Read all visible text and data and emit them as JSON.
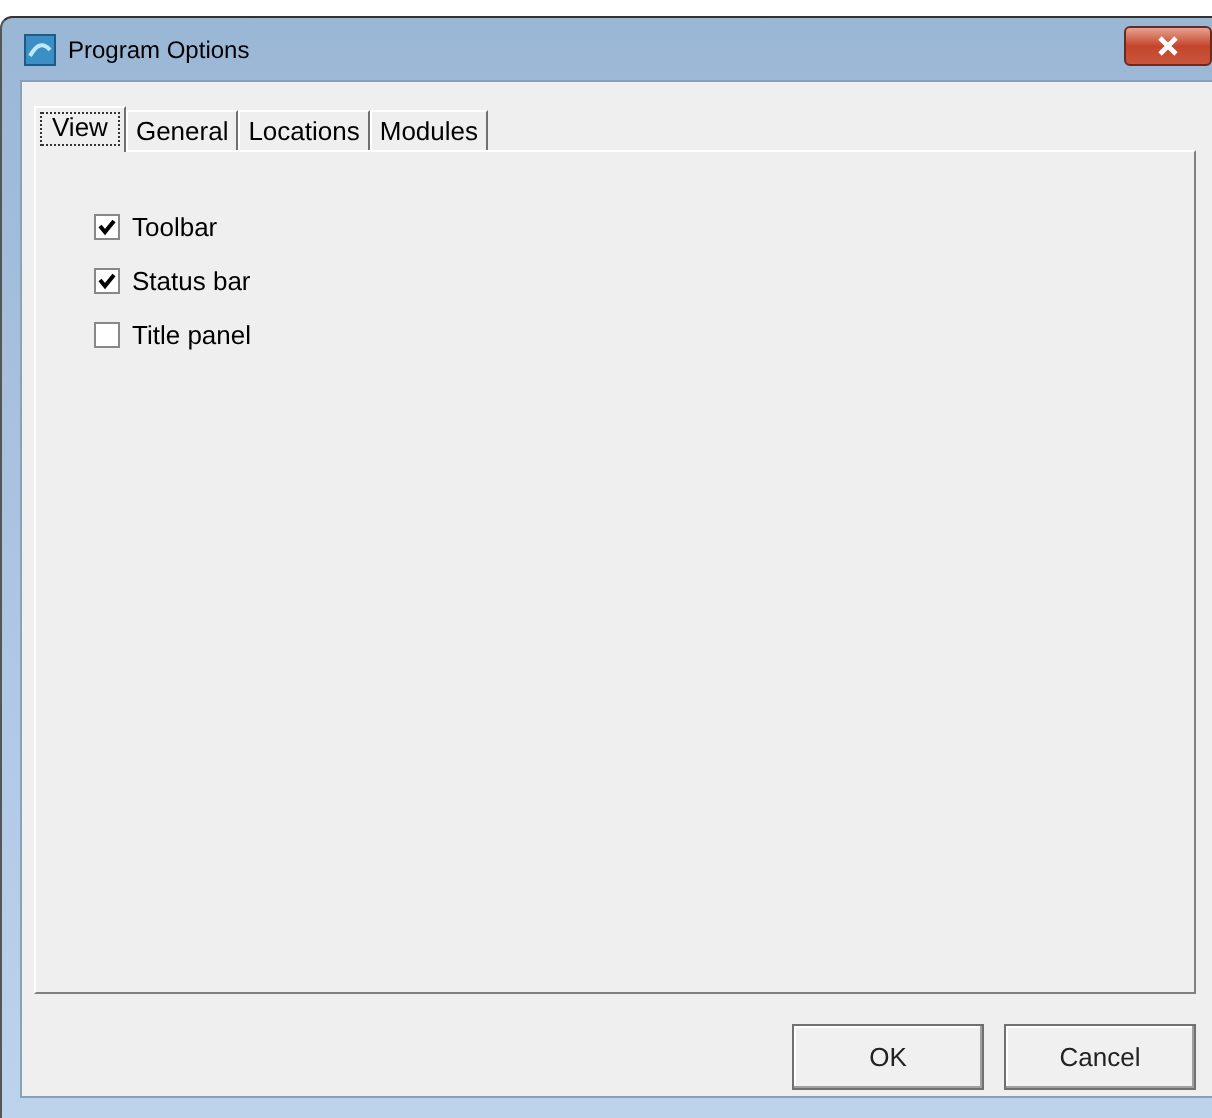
{
  "window": {
    "title": "Program Options"
  },
  "tabs": [
    {
      "label": "View",
      "selected": true
    },
    {
      "label": "General",
      "selected": false
    },
    {
      "label": "Locations",
      "selected": false
    },
    {
      "label": "Modules",
      "selected": false
    }
  ],
  "options": [
    {
      "label": "Toolbar",
      "checked": true
    },
    {
      "label": "Status bar",
      "checked": true
    },
    {
      "label": "Title panel",
      "checked": false
    }
  ],
  "buttons": [
    "OK",
    "Cancel"
  ]
}
